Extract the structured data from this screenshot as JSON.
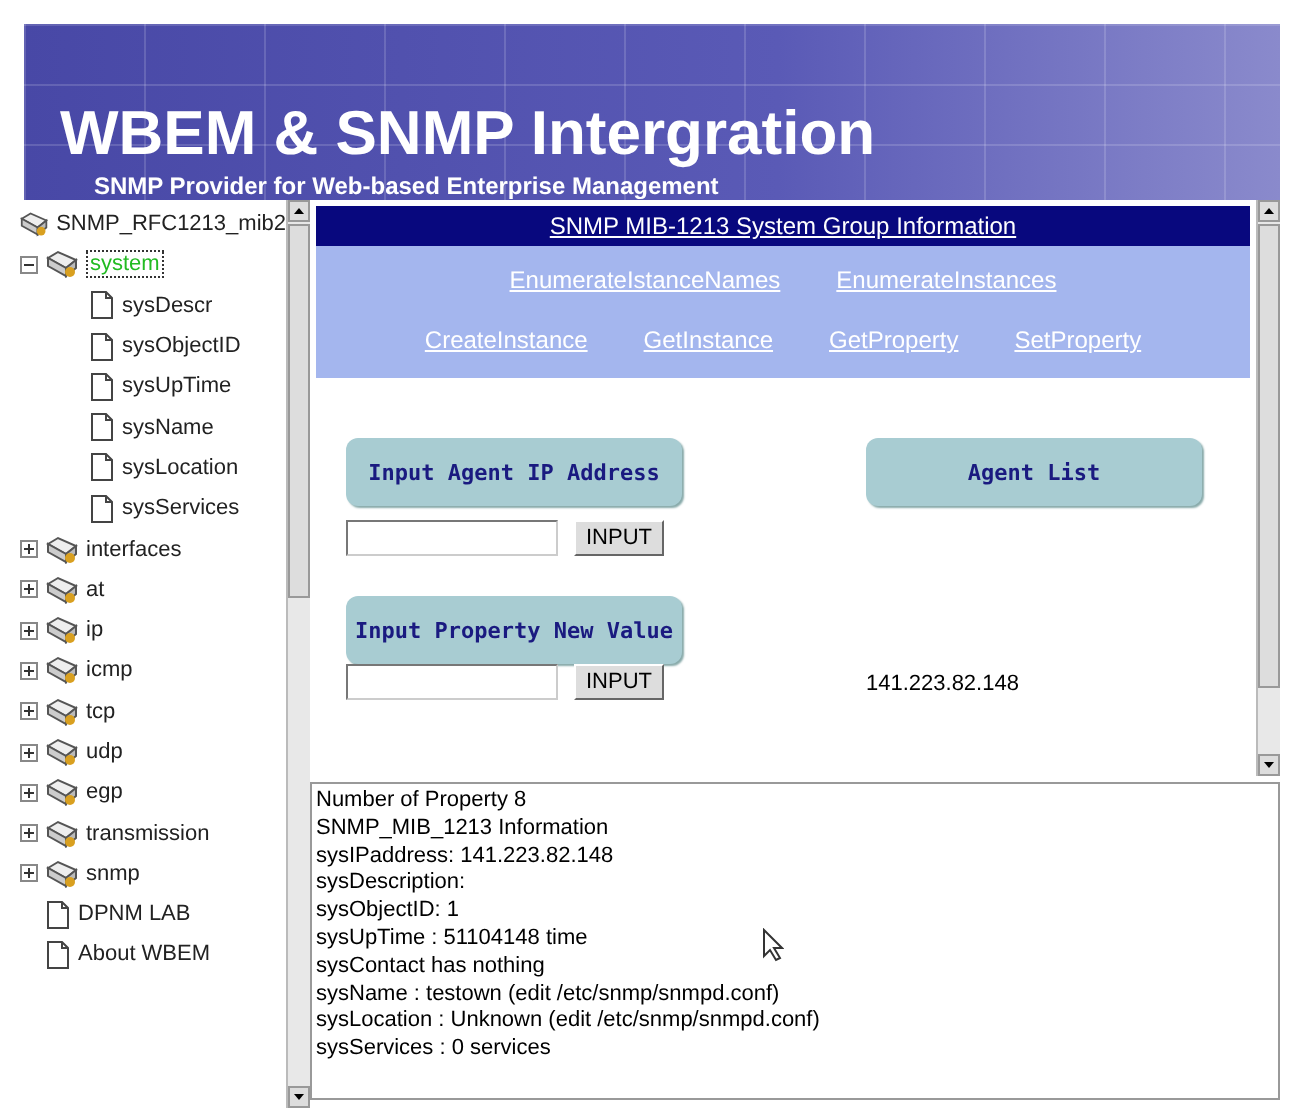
{
  "banner": {
    "title": "WBEM & SNMP Intergration",
    "subtitle": "SNMP Provider for Web-based Enterprise Management"
  },
  "tree": {
    "root": "SNMP_RFC1213_mib2",
    "items": [
      {
        "kind": "folder",
        "label": "system",
        "expanded": true,
        "selected": true,
        "children": [
          {
            "kind": "doc",
            "label": "sysDescr",
            "selected": false
          },
          {
            "kind": "doc",
            "label": "sysObjectID",
            "selected": false
          },
          {
            "kind": "doc",
            "label": "sysUpTime",
            "selected": false
          },
          {
            "kind": "doc",
            "label": "sysName",
            "selected": false
          },
          {
            "kind": "doc",
            "label": "sysLocation",
            "selected": false
          },
          {
            "kind": "doc",
            "label": "sysServices",
            "selected": false
          }
        ]
      },
      {
        "kind": "folder",
        "label": "interfaces",
        "expanded": false,
        "selected": false
      },
      {
        "kind": "folder",
        "label": "at",
        "expanded": false,
        "selected": false
      },
      {
        "kind": "folder",
        "label": "ip",
        "expanded": false,
        "selected": false
      },
      {
        "kind": "folder",
        "label": "icmp",
        "expanded": false,
        "selected": false
      },
      {
        "kind": "folder",
        "label": "tcp",
        "expanded": false,
        "selected": false
      },
      {
        "kind": "folder",
        "label": "udp",
        "expanded": false,
        "selected": false
      },
      {
        "kind": "folder",
        "label": "egp",
        "expanded": false,
        "selected": false
      },
      {
        "kind": "folder",
        "label": "transmission",
        "expanded": false,
        "selected": false
      },
      {
        "kind": "folder",
        "label": "snmp",
        "expanded": false,
        "selected": false
      },
      {
        "kind": "doc",
        "label": "DPNM LAB",
        "selected": false
      },
      {
        "kind": "doc",
        "label": "About WBEM",
        "selected": false
      }
    ]
  },
  "main": {
    "title": "SNMP MIB-1213 System Group Information",
    "link_rows": [
      [
        "EnumerateIstanceNames",
        "EnumerateInstances"
      ],
      [
        "CreateInstance",
        "GetInstance",
        "GetProperty",
        "SetProperty"
      ]
    ],
    "agent_ip": {
      "heading": "Input Agent IP Address",
      "button": "INPUT"
    },
    "agent_list": {
      "heading": "Agent List",
      "agents": [
        "141.223.82.148"
      ]
    },
    "property": {
      "heading": "Input Property New Value",
      "button": "INPUT"
    }
  },
  "output": [
    "Number of Property 8",
    "SNMP_MIB_1213 Information",
    "sysIPaddress: 141.223.82.148",
    "sysDescription:",
    "sysObjectID: 1",
    "sysUpTime : 51104148 time",
    "sysContact has nothing",
    "sysName : testown (edit /etc/snmp/snmpd.conf)",
    "sysLocation : Unknown (edit /etc/snmp/snmpd.conf)",
    "sysServices : 0 services"
  ]
}
